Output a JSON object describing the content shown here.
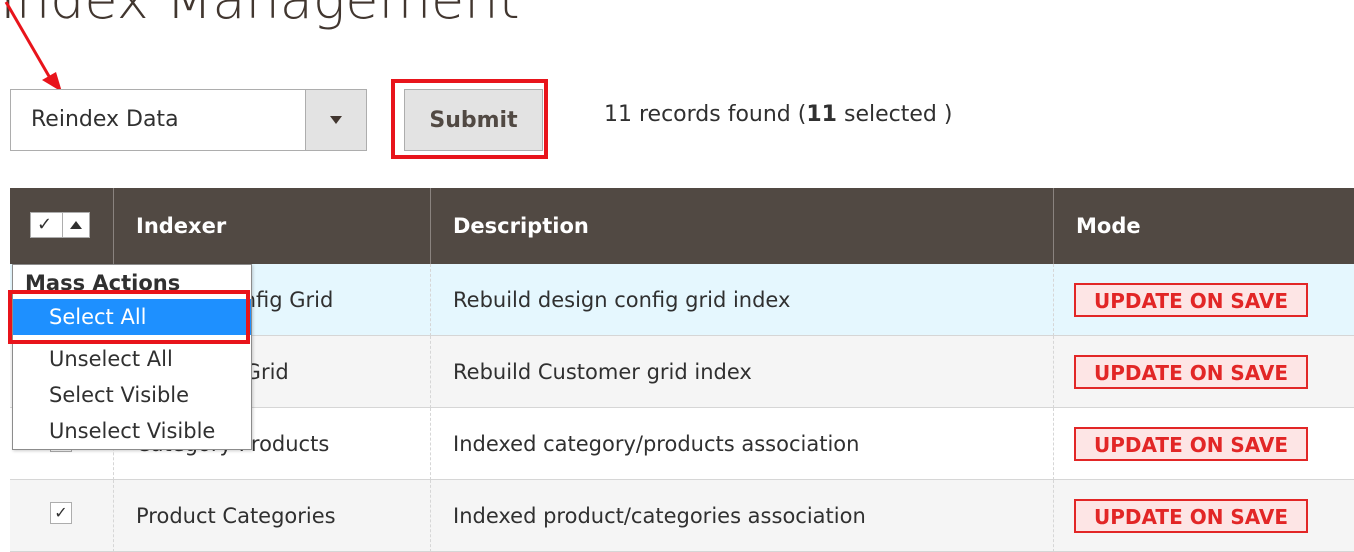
{
  "page": {
    "title": "Index Management"
  },
  "colors": {
    "header_bg": "#514943",
    "row_highlight": "#e5f7fe",
    "badge_red": "#e22626",
    "badge_bg": "#fde5e5",
    "menu_active": "#1e90ff",
    "annotation_red": "#e8141b"
  },
  "toolbar": {
    "action_select_value": "Reindex Data",
    "submit_label": "Submit",
    "records_prefix": "11 records found (",
    "selected_count": "11",
    "records_suffix": " selected )"
  },
  "grid": {
    "columns": [
      {
        "label": "Indexer"
      },
      {
        "label": "Description"
      },
      {
        "label": "Mode"
      }
    ],
    "rows": [
      {
        "indexer": "Design Config Grid",
        "description": "Rebuild design config grid index",
        "mode": "UPDATE ON SAVE",
        "checked": "✓"
      },
      {
        "indexer": "Customer Grid",
        "description": "Rebuild Customer grid index",
        "mode": "UPDATE ON SAVE",
        "checked": "✓"
      },
      {
        "indexer": "Category Products",
        "description": "Indexed category/products association",
        "mode": "UPDATE ON SAVE",
        "checked": "✓"
      },
      {
        "indexer": "Product Categories",
        "description": "Indexed product/categories association",
        "mode": "UPDATE ON SAVE",
        "checked": "✓"
      }
    ]
  },
  "mass_actions": {
    "title": "Mass Actions",
    "items": [
      {
        "label": "Select All"
      },
      {
        "label": "Unselect All"
      },
      {
        "label": "Select Visible"
      },
      {
        "label": "Unselect Visible"
      }
    ],
    "active_index": 0
  },
  "icons": {
    "select_caret": "chevron-down-icon",
    "mass_check": "checkmark-icon",
    "mass_caret": "caret-up-icon",
    "annotation": "red-arrow-icon"
  }
}
